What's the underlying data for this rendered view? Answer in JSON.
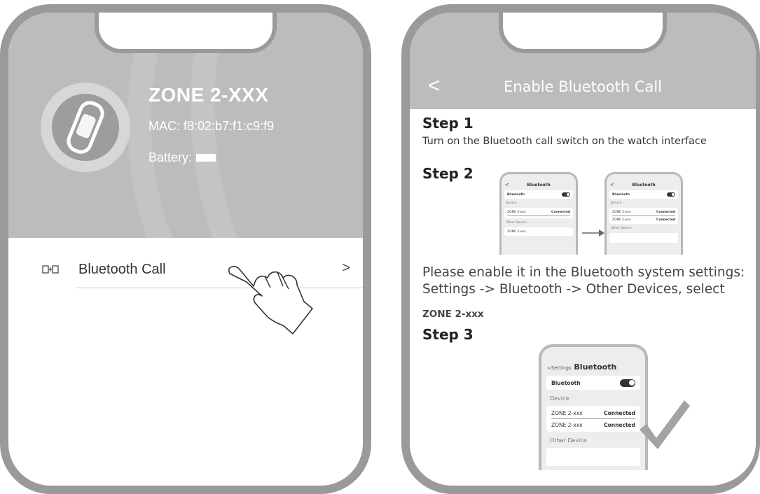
{
  "left": {
    "device_name": "ZONE 2-XXX",
    "mac": "MAC: f8:02:b7:f1:c9:f9",
    "battery_label": "Battery:",
    "menu_item": {
      "label": "Bluetooth Call",
      "chevron": ">"
    },
    "icons": [
      "watch-band-icon",
      "battery-icon",
      "bluetooth-call-icon",
      "chevron-right-icon",
      "pointing-hand-icon"
    ]
  },
  "right": {
    "title": "Enable Bluetooth Call",
    "back": "<",
    "step1": {
      "title": "Step 1",
      "text": "Turn on the Bluetooth call switch on the watch interface"
    },
    "step2": {
      "title": "Step 2",
      "instruction_line1": "Please enable it in the Bluetooth system settings:",
      "instruction_line2": "Settings -> Bluetooth -> Other Devices, select",
      "device_code": "ZONE 2-xxx",
      "mini_a": {
        "back": "<",
        "title": "Bluetooth",
        "toggle_label": "Bluetooth",
        "device_label": "Device",
        "row_name": "ZONE 2-xxx",
        "row_status": "Connected",
        "other_label": "Other Device",
        "other_row": "ZONE 2-xxx"
      },
      "mini_b": {
        "back": "<",
        "title": "Bluetooth",
        "toggle_label": "Bluetooth",
        "device_label": "Device",
        "row1_name": "ZONE 2-xxx",
        "row1_status": "Connected",
        "row2_name": "ZONE 2-xxx",
        "row2_status": "Connected",
        "other_label": "Other Device"
      }
    },
    "step3": {
      "title": "Step 3",
      "phone": {
        "settings": "<Settings",
        "title": "Bluetooth",
        "toggle_label": "Bluetooth",
        "device_label": "Device",
        "row1_name": "ZONE 2-xxx",
        "row1_status": "Connected",
        "row2_name": "ZONE 2-xxx",
        "row2_status": "Connected",
        "other_label": "Other Device"
      }
    }
  },
  "colors": {
    "header_gray": "#bcbcbc",
    "frame_gray": "#9a9a9a"
  }
}
